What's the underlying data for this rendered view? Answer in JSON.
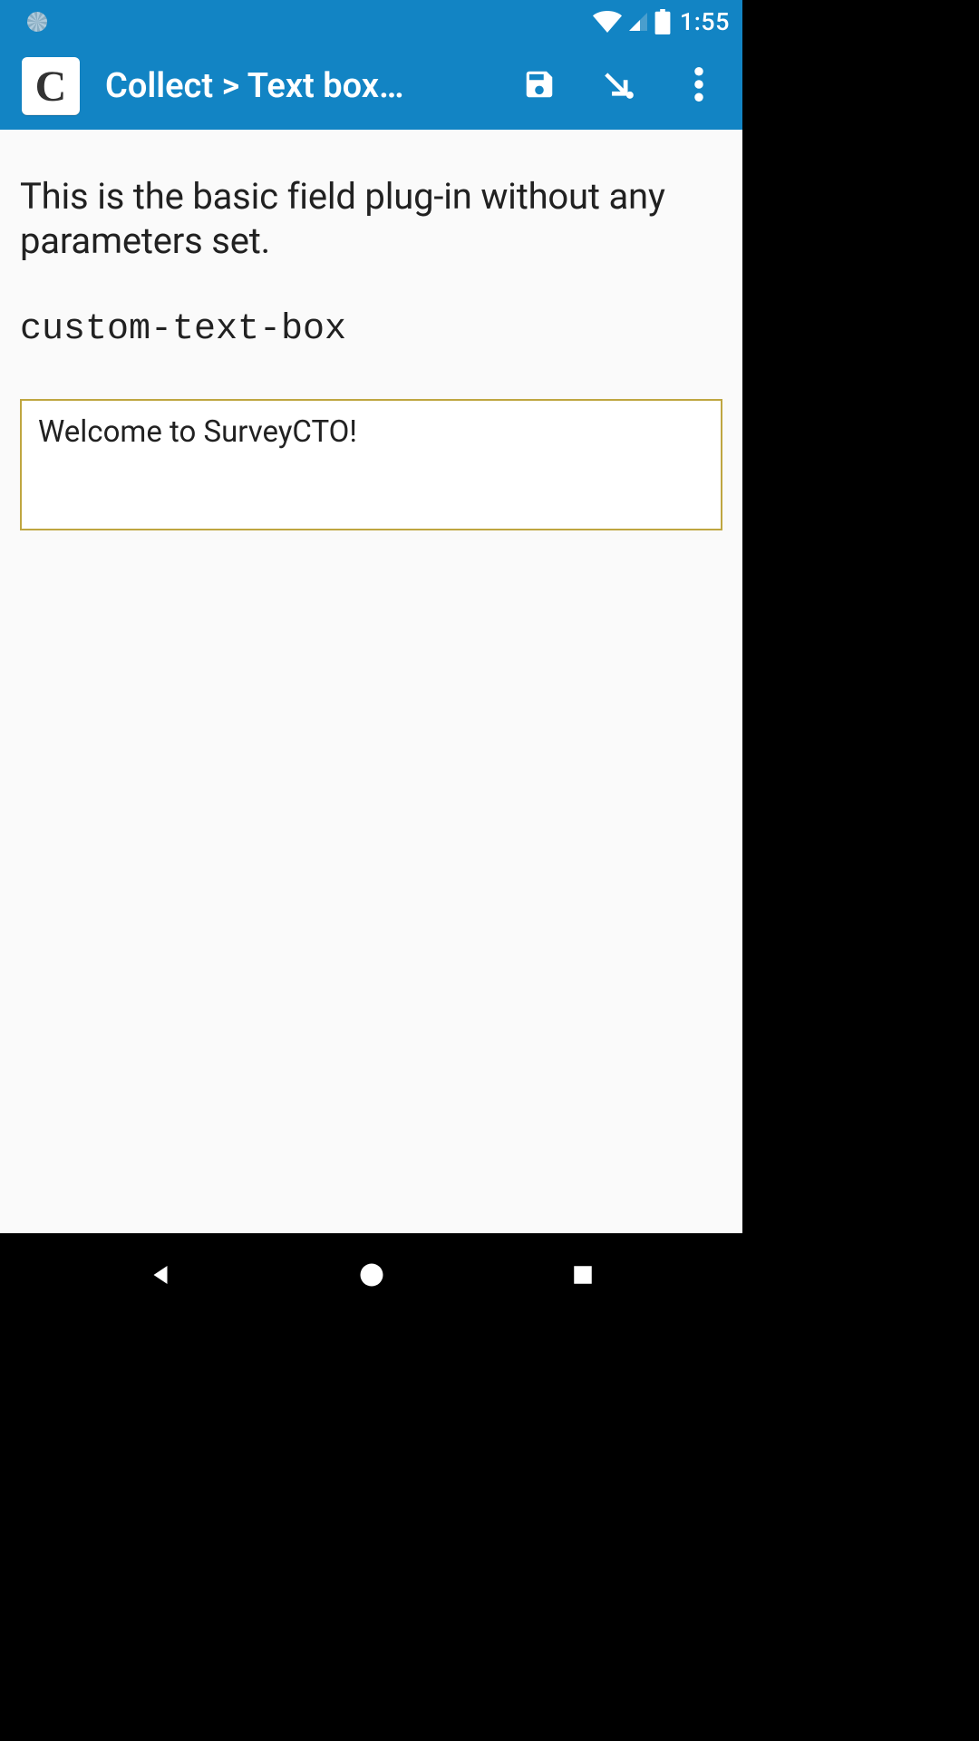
{
  "status": {
    "time": "1:55"
  },
  "appbar": {
    "icon_letter": "C",
    "title": "Collect > Text box…"
  },
  "main": {
    "description": "This is the basic field plug-in without any parameters set.",
    "field_name": "custom-text-box",
    "input_value": "Welcome to SurveyCTO!"
  }
}
